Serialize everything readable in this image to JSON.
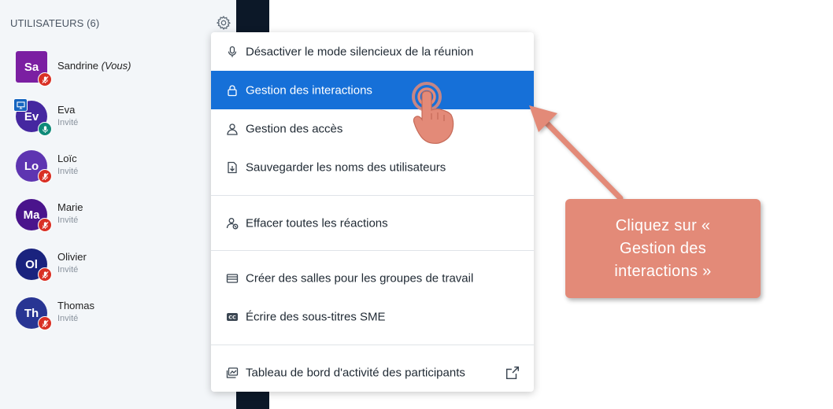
{
  "sidebar": {
    "header": "UTILISATEURS (6)",
    "users": [
      {
        "initials": "Sa",
        "name": "Sandrine",
        "you_label": "(Vous)",
        "role": "",
        "color": "#7b1fa2",
        "square": true,
        "mic": "muted",
        "presenter": false
      },
      {
        "initials": "Ev",
        "name": "Eva",
        "you_label": "",
        "role": "Invité",
        "color": "#4527a0",
        "square": false,
        "mic": "on",
        "presenter": true
      },
      {
        "initials": "Lo",
        "name": "Loïc",
        "you_label": "",
        "role": "Invité",
        "color": "#5e35b1",
        "square": false,
        "mic": "muted",
        "presenter": false
      },
      {
        "initials": "Ma",
        "name": "Marie",
        "you_label": "",
        "role": "Invité",
        "color": "#4a148c",
        "square": false,
        "mic": "muted",
        "presenter": false
      },
      {
        "initials": "Ol",
        "name": "Olivier",
        "you_label": "",
        "role": "Invité",
        "color": "#1a237e",
        "square": false,
        "mic": "muted",
        "presenter": false
      },
      {
        "initials": "Th",
        "name": "Thomas",
        "you_label": "",
        "role": "Invité",
        "color": "#283593",
        "square": false,
        "mic": "muted",
        "presenter": false
      }
    ]
  },
  "menu": {
    "items": [
      {
        "icon": "microphone-icon",
        "label": "Désactiver le mode silencieux de la réunion"
      },
      {
        "icon": "lock-icon",
        "label": "Gestion des interactions"
      },
      {
        "icon": "user-icon",
        "label": "Gestion des accès"
      },
      {
        "icon": "download-file-icon",
        "label": "Sauvegarder les noms des utilisateurs"
      },
      {
        "icon": "user-clear-icon",
        "label": "Effacer toutes les réactions"
      },
      {
        "icon": "breakout-rooms-icon",
        "label": "Créer des salles pour les groupes de travail"
      },
      {
        "icon": "closed-caption-icon",
        "label": "Écrire des sous-titres SME"
      },
      {
        "icon": "dashboard-icon",
        "label": "Tableau de bord d'activité des participants"
      }
    ]
  },
  "callout": {
    "text": "Cliquez sur « Gestion des interactions »"
  },
  "colors": {
    "accent": "#1670d8",
    "callout": "#e38a78",
    "muted": "#d93025",
    "mic_on": "#0f8a79"
  }
}
